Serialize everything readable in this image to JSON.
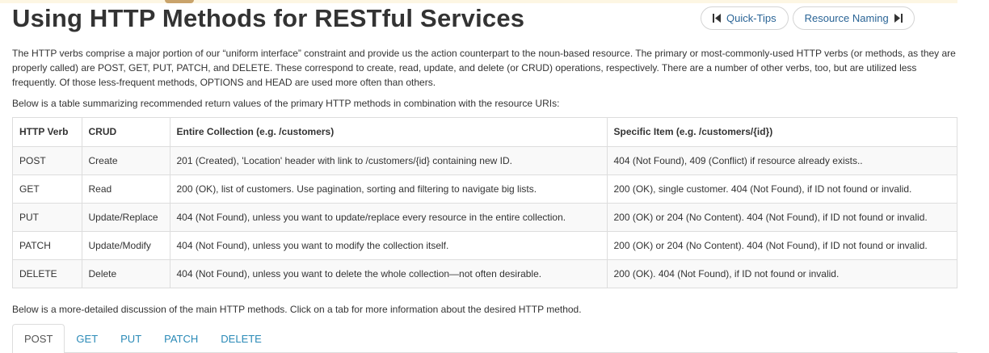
{
  "page": {
    "title": "Using HTTP Methods for RESTful Services"
  },
  "pager": {
    "prev_label": "Quick-Tips",
    "next_label": "Resource Naming",
    "prev_icon": "step-backward-icon",
    "next_icon": "step-forward-icon"
  },
  "intro": {
    "paragraph": "The HTTP verbs comprise a major portion of our “uniform interface” constraint and provide us the action counterpart to the noun-based resource. The primary or most-commonly-used HTTP verbs (or methods, as they are properly called) are POST, GET, PUT, PATCH, and DELETE. These correspond to create, read, update, and delete (or CRUD) operations, respectively. There are a number of other verbs, too, but are utilized less frequently. Of those less-frequent methods, OPTIONS and HEAD are used more often than others.",
    "table_caption": "Below is a table summarizing recommended return values of the primary HTTP methods in combination with the resource URIs:"
  },
  "table": {
    "headers": [
      "HTTP Verb",
      "CRUD",
      "Entire Collection (e.g. /customers)",
      "Specific Item (e.g. /customers/{id})"
    ],
    "rows": [
      [
        "POST",
        "Create",
        "201 (Created), 'Location' header with link to /customers/{id} containing new ID.",
        "404 (Not Found), 409 (Conflict) if resource already exists.."
      ],
      [
        "GET",
        "Read",
        "200 (OK), list of customers. Use pagination, sorting and filtering to navigate big lists.",
        "200 (OK), single customer. 404 (Not Found), if ID not found or invalid."
      ],
      [
        "PUT",
        "Update/Replace",
        "404 (Not Found), unless you want to update/replace every resource in the entire collection.",
        "200 (OK) or 204 (No Content). 404 (Not Found), if ID not found or invalid."
      ],
      [
        "PATCH",
        "Update/Modify",
        "404 (Not Found), unless you want to modify the collection itself.",
        "200 (OK) or 204 (No Content). 404 (Not Found), if ID not found or invalid."
      ],
      [
        "DELETE",
        "Delete",
        "404 (Not Found), unless you want to delete the whole collection—not often desirable.",
        "200 (OK). 404 (Not Found), if ID not found or invalid."
      ]
    ]
  },
  "detail": {
    "caption": "Below is a more-detailed discussion of the main HTTP methods. Click on a tab for more information about the desired HTTP method."
  },
  "tabs": [
    {
      "label": "POST",
      "active": true
    },
    {
      "label": "GET",
      "active": false
    },
    {
      "label": "PUT",
      "active": false
    },
    {
      "label": "PATCH",
      "active": false
    },
    {
      "label": "DELETE",
      "active": false
    }
  ],
  "colors": {
    "link": "#2a6496",
    "tab_link": "#2a8ab7",
    "text": "#333333",
    "border": "#dddddd",
    "stripe": "#f9f9f9"
  }
}
